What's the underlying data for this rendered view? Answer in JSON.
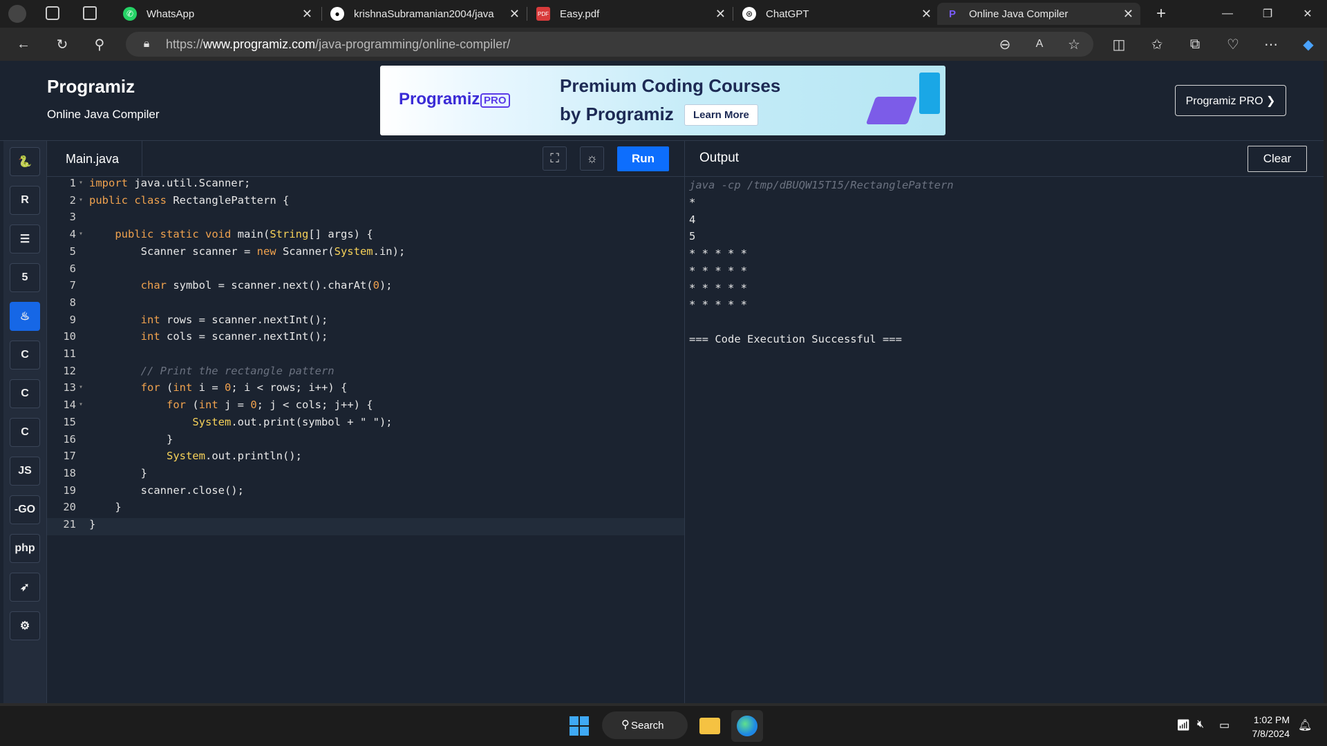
{
  "browser": {
    "tabs": [
      {
        "title": "WhatsApp"
      },
      {
        "title": "krishnaSubramanian2004/java"
      },
      {
        "title": "Easy.pdf"
      },
      {
        "title": "ChatGPT"
      },
      {
        "title": "Online Java Compiler"
      }
    ],
    "url_prefix": "https://",
    "url_domain": "www.programiz.com",
    "url_path": "/java-programming/online-compiler/"
  },
  "header": {
    "logo": "Programiz",
    "subtitle": "Online Java Compiler",
    "pro_button": "Programiz PRO ❯"
  },
  "banner": {
    "logo": "Programiz",
    "badge": "PRO",
    "line1": "Premium Coding Courses",
    "line2": "by Programiz",
    "cta": "Learn More"
  },
  "sidebar": {
    "languages": [
      {
        "icon": "python-icon",
        "glyph": "🐍"
      },
      {
        "icon": "r-icon",
        "glyph": "R"
      },
      {
        "icon": "sql-icon",
        "glyph": "☰"
      },
      {
        "icon": "html-icon",
        "glyph": "5"
      },
      {
        "icon": "java-icon",
        "glyph": "♨",
        "active": true
      },
      {
        "icon": "c-icon",
        "glyph": "C"
      },
      {
        "icon": "cpp-icon",
        "glyph": "C"
      },
      {
        "icon": "csharp-icon",
        "glyph": "C"
      },
      {
        "icon": "javascript-icon",
        "glyph": "JS"
      },
      {
        "icon": "go-icon",
        "glyph": "-GO"
      },
      {
        "icon": "php-icon",
        "glyph": "php"
      },
      {
        "icon": "swift-icon",
        "glyph": "➶"
      },
      {
        "icon": "rust-icon",
        "glyph": "⚙"
      }
    ]
  },
  "editor": {
    "filename": "Main.java",
    "run_label": "Run",
    "lines": [
      "import java.util.Scanner;",
      "public class RectanglePattern {",
      "",
      "    public static void main(String[] args) {",
      "        Scanner scanner = new Scanner(System.in);",
      "",
      "        char symbol = scanner.next().charAt(0);",
      "",
      "        int rows = scanner.nextInt();",
      "        int cols = scanner.nextInt();",
      "",
      "        // Print the rectangle pattern",
      "        for (int i = 0; i < rows; i++) {",
      "            for (int j = 0; j < cols; j++) {",
      "                System.out.print(symbol + \" \");",
      "            }",
      "            System.out.println();",
      "        }",
      "        scanner.close();",
      "    }",
      "}"
    ]
  },
  "output": {
    "title": "Output",
    "clear_label": "Clear",
    "command": "java -cp /tmp/dBUQW15T15/RectanglePattern",
    "lines": [
      "*",
      "4",
      "5",
      "* * * * *",
      "* * * * *",
      "* * * * *",
      "* * * * *",
      "",
      "=== Code Execution Successful ==="
    ]
  },
  "taskbar": {
    "search_label": "Search",
    "time": "1:02 PM",
    "date": "7/8/2024"
  }
}
